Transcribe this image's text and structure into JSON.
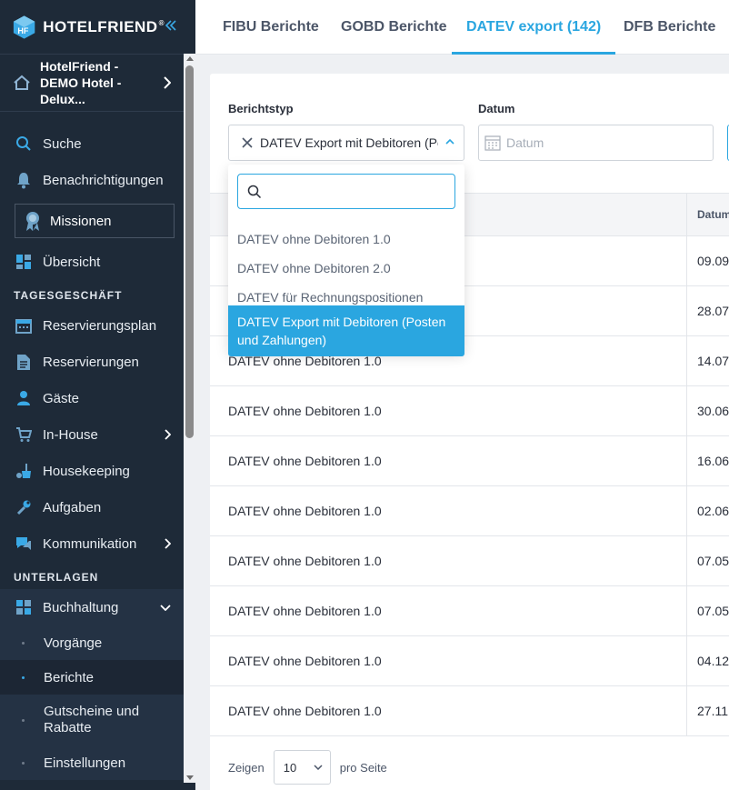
{
  "brand": {
    "name": "HOTELFRIEND",
    "reg": "®"
  },
  "hotel": {
    "name": "HotelFriend - DEMO Hotel - Delux..."
  },
  "nav": {
    "search": "Suche",
    "notifications": "Benachrichtigungen",
    "missions": "Missionen",
    "overview": "Übersicht",
    "section_daily": "TAGESGESCHÄFT",
    "reservation_plan": "Reservierungsplan",
    "reservations": "Reservierungen",
    "guests": "Gäste",
    "in_house": "In-House",
    "housekeeping": "Housekeeping",
    "tasks": "Aufgaben",
    "communication": "Kommunikation",
    "section_docs": "UNTERLAGEN",
    "accounting": "Buchhaltung",
    "sub_processes": "Vorgänge",
    "sub_reports": "Berichte",
    "sub_vouchers": "Gutscheine und Rabatte",
    "sub_settings": "Einstellungen"
  },
  "tabs": [
    "FIBU Berichte",
    "GOBD Berichte",
    "DATEV export (142)",
    "DFB Berichte"
  ],
  "filters": {
    "report_type_label": "Berichtstyp",
    "report_type_value": "DATEV Export mit Debitoren (Posten und Zahlungen)",
    "date_label": "Datum",
    "date_placeholder": "Datum"
  },
  "table": {
    "col_date": "Datum",
    "rows": [
      {
        "name": "",
        "date": "09.09"
      },
      {
        "name": "",
        "date": "28.07"
      },
      {
        "name": "DATEV ohne Debitoren 1.0",
        "date": "14.07"
      },
      {
        "name": "DATEV ohne Debitoren 1.0",
        "date": "30.06"
      },
      {
        "name": "DATEV ohne Debitoren 1.0",
        "date": "16.06"
      },
      {
        "name": "DATEV ohne Debitoren 1.0",
        "date": "02.06"
      },
      {
        "name": "DATEV ohne Debitoren 1.0",
        "date": "07.05"
      },
      {
        "name": "DATEV ohne Debitoren 1.0",
        "date": "07.05"
      },
      {
        "name": "DATEV ohne Debitoren 1.0",
        "date": "04.12"
      },
      {
        "name": "DATEV ohne Debitoren 1.0",
        "date": "27.11"
      }
    ]
  },
  "pager": {
    "show": "Zeigen",
    "per_page_value": "10",
    "per_page": "pro Seite"
  },
  "dropdown": {
    "search_value": "",
    "options": [
      "DATEV ohne Debitoren 1.0",
      "DATEV ohne Debitoren 2.0",
      "DATEV für Rechnungspositionen",
      "DATEV Export mit Debitoren (Posten und Zahlungen)"
    ],
    "selected_index": 3
  },
  "colors": {
    "accent": "#2aa6e0",
    "sidebar": "#1e2a38"
  }
}
